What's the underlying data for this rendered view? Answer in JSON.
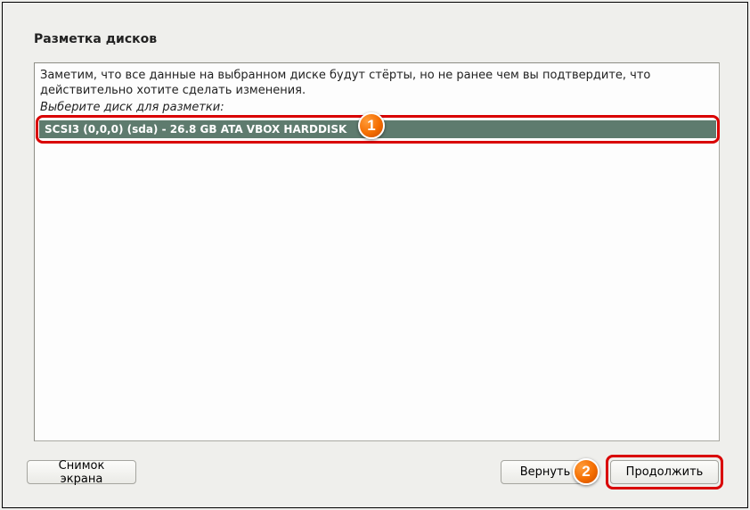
{
  "title": "Разметка дисков",
  "warning": "Заметим, что все данные на выбранном диске будут стёрты, но не ранее чем вы подтвердите, что действительно хотите сделать изменения.",
  "prompt": "Выберите диск для разметки:",
  "disk": "SCSI3 (0,0,0) (sda) - 26.8 GB ATA VBOX HARDDISK",
  "buttons": {
    "screenshot": "Снимок экрана",
    "back": "Вернуть",
    "continue": "Продолжить"
  },
  "annotations": {
    "badge1": "1",
    "badge2": "2"
  }
}
